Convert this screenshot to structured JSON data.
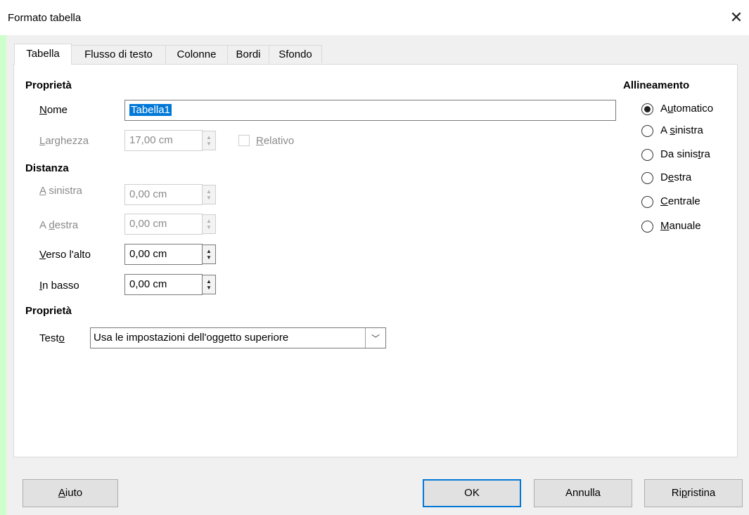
{
  "window": {
    "title": "Formato tabella",
    "close_icon": "close-icon"
  },
  "tabs": [
    "Tabella",
    "Flusso di testo",
    "Colonne",
    "Bordi",
    "Sfondo"
  ],
  "properties": {
    "header": "Proprietà",
    "name_label_u": "N",
    "name_label_rest": "ome",
    "name_value": "Tabella1",
    "width_label_u": "L",
    "width_label_rest": "arghezza",
    "width_value": "17,00 cm",
    "relative_u": "R",
    "relative_rest": "elativo"
  },
  "spacing": {
    "header": "Distanza",
    "left_u": "A",
    "left_rest": " sinistra",
    "left_value": "0,00 cm",
    "right_pre": "A ",
    "right_u": "d",
    "right_rest": "estra",
    "right_value": "0,00 cm",
    "top_u": "V",
    "top_rest": "erso l'alto",
    "top_value": "0,00 cm",
    "bottom_u": "I",
    "bottom_rest": "n basso",
    "bottom_value": "0,00 cm"
  },
  "properties2": {
    "header": "Proprietà",
    "text_pre": "Test",
    "text_u": "o",
    "text_value": "Usa le impostazioni dell'oggetto superiore"
  },
  "alignment": {
    "header": "Allineamento",
    "automatic_pre": "A",
    "automatic_u": "u",
    "automatic_rest": "tomatico",
    "left_pre": "A ",
    "left_u": "s",
    "left_rest": "inistra",
    "fromleft_pre": "Da sinis",
    "fromleft_u": "t",
    "fromleft_rest": "ra",
    "right_pre": "D",
    "right_u": "e",
    "right_rest": "stra",
    "center_u": "C",
    "center_rest": "entrale",
    "manual_u": "M",
    "manual_rest": "anuale",
    "selected": "automatic"
  },
  "buttons": {
    "help_u": "A",
    "help_rest": "iuto",
    "ok": "OK",
    "cancel": "Annulla",
    "reset_pre": "Ri",
    "reset_u": "p",
    "reset_rest": "ristina"
  },
  "colors": {
    "accent": "#0078d7",
    "left_strip": "#ccffcc"
  }
}
